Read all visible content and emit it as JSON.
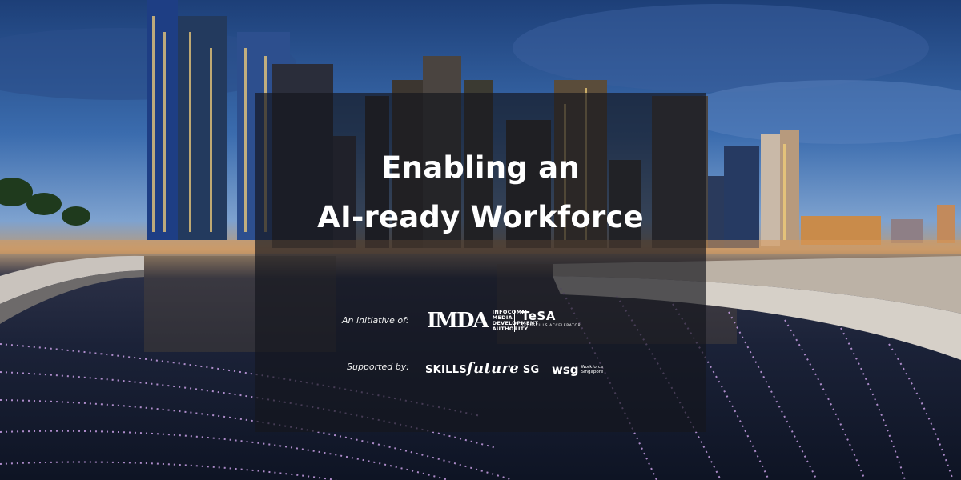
{
  "headline": {
    "line1": "Enabling an",
    "line2": "AI-ready Workforce"
  },
  "initiative": {
    "label": "An initiative of:",
    "imda_mark": "IMDA",
    "imda_name_lines": [
      "INFOCOMM",
      "MEDIA",
      "DEVELOPMENT",
      "AUTHORITY"
    ],
    "tesa_name": "TeSA",
    "tesa_tagline": "TECHSKILLS ACCELERATOR"
  },
  "supported": {
    "label": "Supported by:",
    "skills_prefix": "SKILLS",
    "skills_script": "future",
    "skills_suffix": "SG",
    "wsg_mark": "wsg",
    "wsg_name_lines": [
      "Workforce",
      "Singapore"
    ]
  },
  "colors": {
    "overlay": "#14161e",
    "text": "#ffffff"
  }
}
